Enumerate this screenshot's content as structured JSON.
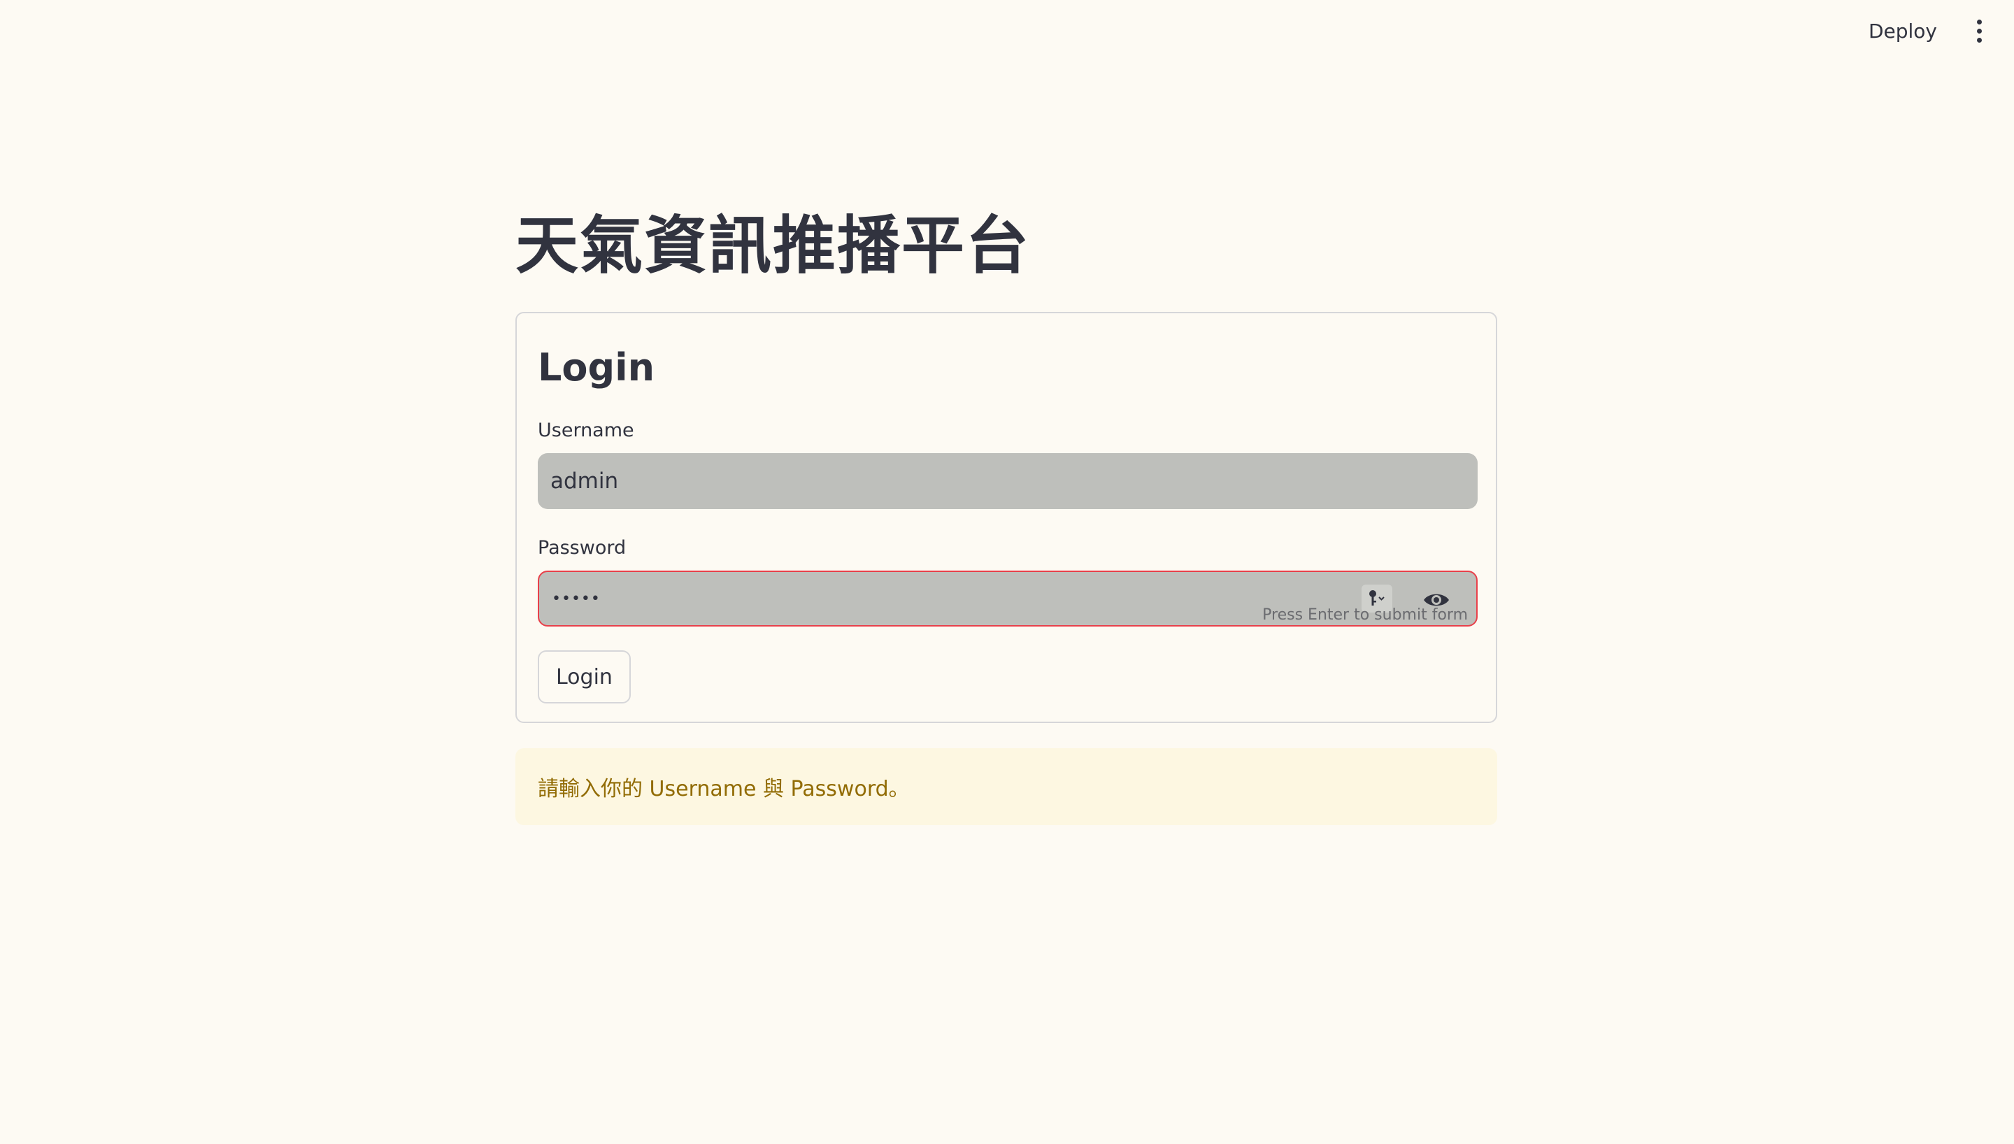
{
  "toolbar": {
    "deploy_label": "Deploy",
    "menu_icon": "vertical-dots-icon"
  },
  "app": {
    "title": "天氣資訊推播平台"
  },
  "login_form": {
    "title": "Login",
    "username": {
      "label": "Username",
      "value": "admin"
    },
    "password": {
      "label": "Password",
      "value": "•••••",
      "hint": "Press Enter to submit form",
      "key_icon": "key-icon",
      "reveal_icon": "eye-icon"
    },
    "submit_label": "Login"
  },
  "alert": {
    "message": "請輸入你的 Username 與 Password。"
  },
  "colors": {
    "background": "#fdfaf3",
    "input_background": "#bebfbb",
    "error_border": "#e8404a",
    "alert_background": "#fdf7e1",
    "alert_text": "#926c05",
    "text": "#31333f"
  }
}
